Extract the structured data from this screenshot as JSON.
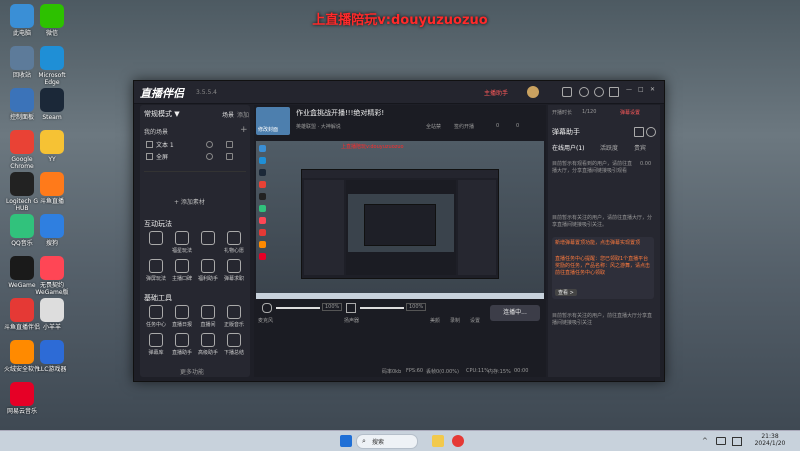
{
  "watermark": "上直播陪玩v:douyuzuozuo",
  "desktop": {
    "icons": [
      {
        "label": "此电脑",
        "icon": "computer-icon",
        "color": "#3a8fd6"
      },
      {
        "label": "微信",
        "icon": "wechat-icon",
        "color": "#2dc100"
      },
      {
        "label": "回收站",
        "icon": "recycle-bin-icon",
        "color": "#5d7b9a"
      },
      {
        "label": "Microsoft Edge",
        "icon": "edge-icon",
        "color": "#1f8fd6"
      },
      {
        "label": "控制面板",
        "icon": "control-panel-icon",
        "color": "#3b73b9"
      },
      {
        "label": "Steam",
        "icon": "steam-icon",
        "color": "#1b2838"
      },
      {
        "label": "Google Chrome",
        "icon": "chrome-icon",
        "color": "#e94235"
      },
      {
        "label": "YY",
        "icon": "yy-icon",
        "color": "#f6c234"
      },
      {
        "label": "Logitech G HUB",
        "icon": "logitech-icon",
        "color": "#222222"
      },
      {
        "label": "斗鱼直播",
        "icon": "douyu-icon",
        "color": "#ff7a1a"
      },
      {
        "label": "QQ音乐",
        "icon": "qqmusic-icon",
        "color": "#31c27c"
      },
      {
        "label": "搜狗",
        "icon": "sogou-icon",
        "color": "#2f7fe0"
      },
      {
        "label": "WeGame",
        "icon": "wegame-icon",
        "color": "#1a1a1a"
      },
      {
        "label": "无畏契约 WeGame版",
        "icon": "valorant-icon",
        "color": "#ff4655"
      },
      {
        "label": "斗鱼直播伴侣",
        "icon": "douyu-assistant-icon",
        "color": "#e53935"
      },
      {
        "label": "小羊羊",
        "icon": "doc-icon",
        "color": "#dddddd"
      },
      {
        "label": "火绒安全软件",
        "icon": "huorong-icon",
        "color": "#ff8a00"
      },
      {
        "label": "LLC游戏器",
        "icon": "llc-icon",
        "color": "#2d6bd6"
      },
      {
        "label": "网易云音乐",
        "icon": "netease-music-icon",
        "color": "#e60026"
      }
    ]
  },
  "app": {
    "name": "直播伴侣",
    "version": "3.5.5.4",
    "top_bar": {
      "tip": "主播助手",
      "minimize": "—",
      "maximize": "□",
      "close": "✕"
    },
    "left": {
      "mode_label": "常规模式 ▼",
      "tab_scene": "场景",
      "tab_source": "添加",
      "my_scenes": "我的场景",
      "scene_tabs": [
        "",
        ""
      ],
      "scenes": [
        {
          "name": "文本 1"
        },
        {
          "name": "全屏"
        }
      ],
      "add_source": "+ 添加素材",
      "interactive_title": "互动玩法",
      "interactive_tools": [
        "",
        "福星玩法",
        "",
        "礼物心愿",
        "弹屏玩法",
        "主播口碑",
        "福利助手",
        "弹幕求职"
      ],
      "basic_title": "基础工具",
      "basic_tools": [
        "任务中心",
        "直播日报",
        "直播间",
        "正版音乐",
        "弹幕库",
        "直播助手",
        "高级助手",
        "下播总结"
      ],
      "more": "更多功能"
    },
    "stream": {
      "title": "作业盒挑战开播!!!绝对精彩!",
      "category": "英雄联盟 · 大神解说",
      "room_id": "",
      "thumb_label": "修改封面",
      "mute_label": "全站禁",
      "gift_label": "签约开播",
      "like_count": "0",
      "share_count": "0"
    },
    "preview_overlay": "上直播陪玩v:douyuzuozuo",
    "audio": {
      "mic_label": "麦克风",
      "mic_value": "100%",
      "speaker_label": "扬声器",
      "speaker_value": "100%",
      "btn_beauty": "美颜",
      "btn_record": "录制",
      "btn_settings": "设置",
      "live_button": "连播中..."
    },
    "status": {
      "bitrate": "码率0kb",
      "fps": "FPS:60",
      "dropped": "丢帧0(0.00%)",
      "cpu": "CPU:11%",
      "memory": "内存:15%",
      "time": "00:00"
    },
    "right": {
      "open_live": "开播时长",
      "viewer_count": "1/120",
      "settings_label": "弹幕设置",
      "panel_title": "弹幕助手",
      "tabs": [
        "在线用户(1)",
        "活跃度",
        "贵宾"
      ],
      "hint1": "目前暂示有观看到的用户，请前往直播大厅，分享直播间链接吸引观看",
      "hint2": "目前暂示有关注的用户，请前往直播大厅，分享直播间链接吸引关注。",
      "count": "0.00",
      "notice_title": "新增弹幕置顶功能，点击弹幕实现置顶",
      "notice_body": "直播任务中心提醒：您已领取1个直播平台奖励的任务，产品名称：风之游舞，请点击前往直播任务中心领取",
      "notice_btn": "查看 >",
      "footer": "目前暂示有关注的用户，前往直播大厅分享直播间链接吸引关注"
    }
  },
  "taskbar": {
    "search_placeholder": "搜索",
    "clock_time": "21:38",
    "clock_date": "2024/1/20"
  }
}
